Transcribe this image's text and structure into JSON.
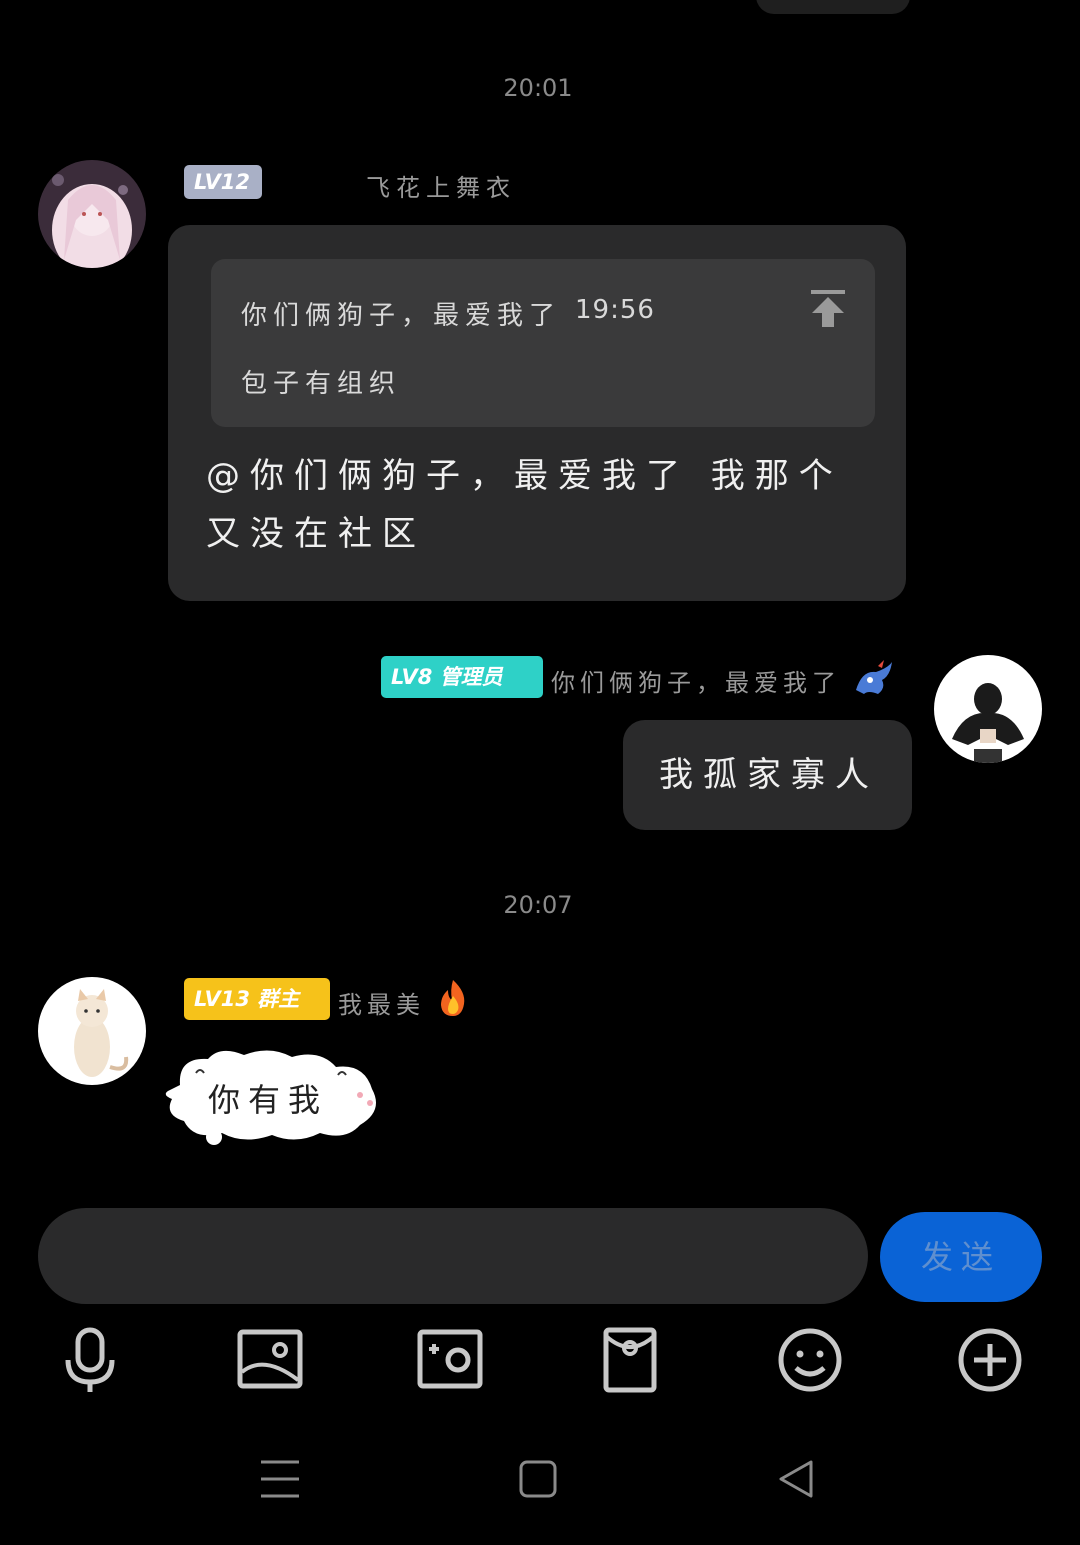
{
  "timestamps": [
    "20:01",
    "20:07"
  ],
  "messages": [
    {
      "badge": "LV12",
      "nickname": "飞花上舞衣",
      "quote": {
        "author": "你们俩狗子，最爱我了",
        "time": "19:56",
        "text": "包子有组织"
      },
      "text": "@你们俩狗子，最爱我了 我那个又没在社区"
    },
    {
      "badge": "LV8 管理员",
      "nickname": "你们俩狗子，最爱我了",
      "text": "我孤家寡人"
    },
    {
      "badge": "LV13 群主",
      "nickname": "我最美",
      "sticker_text": "你有我"
    }
  ],
  "composer": {
    "send_label": "发送"
  },
  "toolbar": [
    "microphone-icon",
    "image-icon",
    "camera-icon",
    "red-packet-icon",
    "emoji-icon",
    "plus-icon"
  ],
  "navbar": [
    "menu-icon",
    "home-icon",
    "back-icon"
  ],
  "colors": {
    "send_button": "#0a63d6",
    "badge_lv12": "#a9b0c6",
    "badge_lv8": "#2ed1c7",
    "badge_lv13": "#f6c21a"
  }
}
